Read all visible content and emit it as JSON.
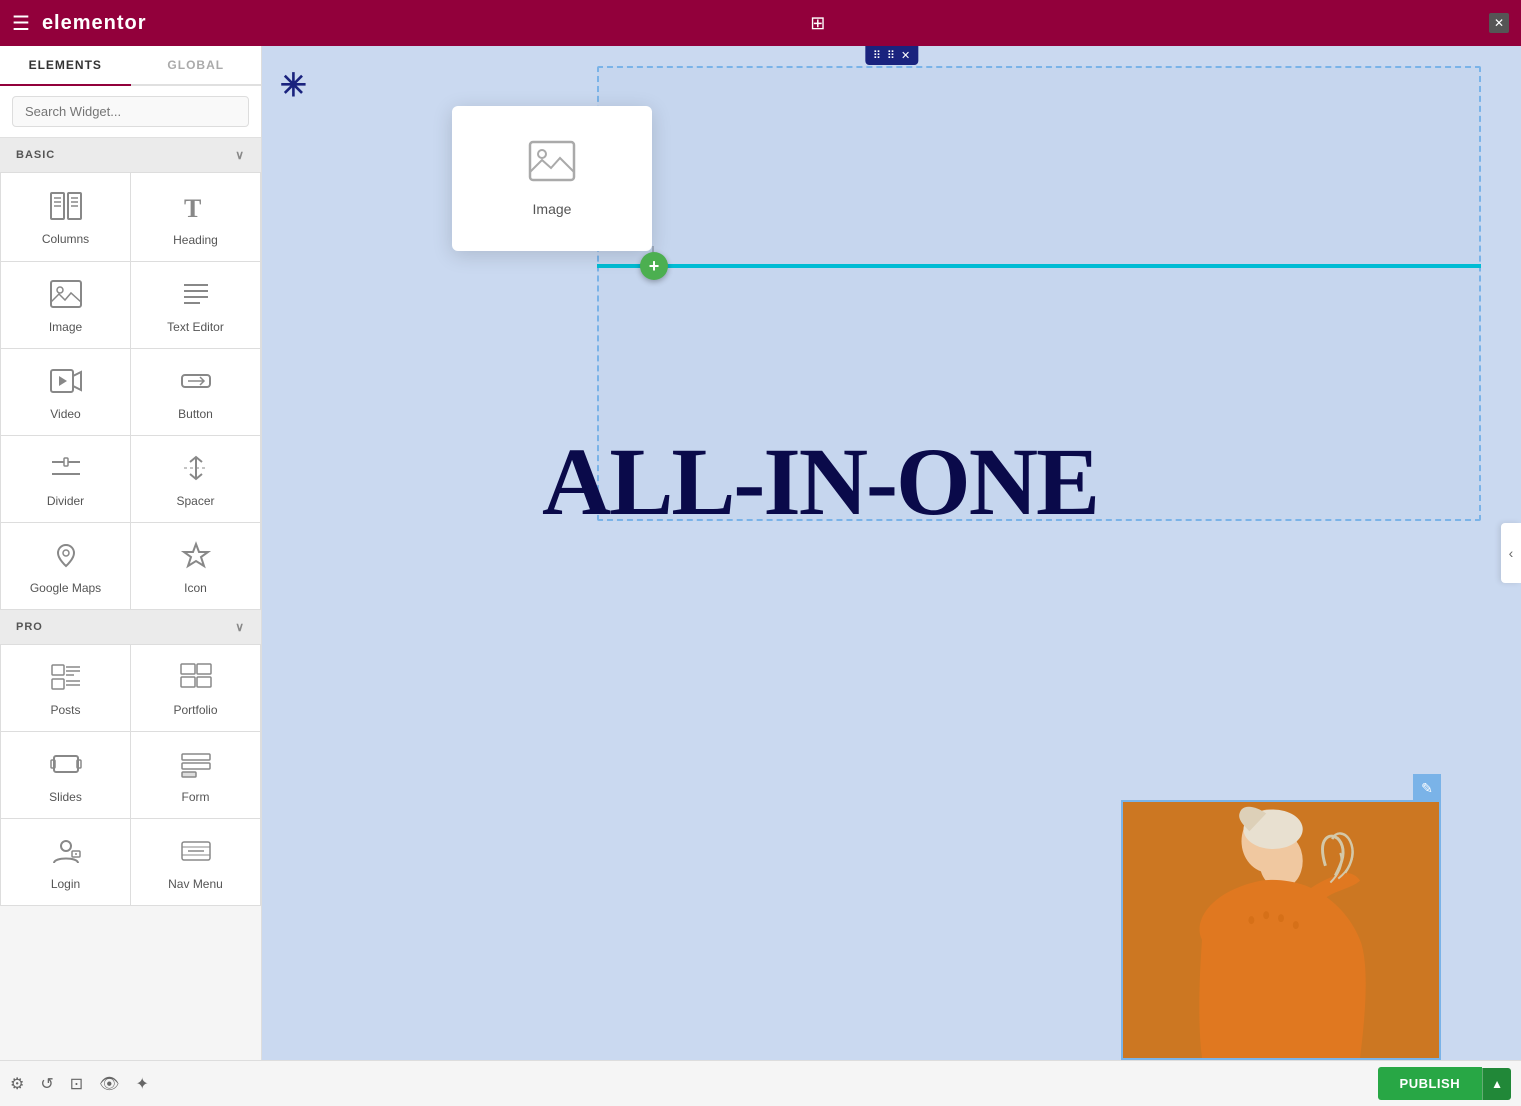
{
  "topbar": {
    "logo_text": "elementor",
    "hamburger_title": "Menu",
    "grid_title": "Apps",
    "close_title": "Close"
  },
  "panel": {
    "tab_elements": "ELEMENTS",
    "tab_global": "GLOBAL",
    "search_placeholder": "Search Widget...",
    "section_basic": "BASIC",
    "section_pro": "PRO",
    "basic_widgets": [
      {
        "id": "columns",
        "label": "Columns",
        "icon": "columns"
      },
      {
        "id": "heading",
        "label": "Heading",
        "icon": "heading"
      },
      {
        "id": "image",
        "label": "Image",
        "icon": "image"
      },
      {
        "id": "text-editor",
        "label": "Text Editor",
        "icon": "text-editor"
      },
      {
        "id": "video",
        "label": "Video",
        "icon": "video"
      },
      {
        "id": "button",
        "label": "Button",
        "icon": "button"
      },
      {
        "id": "divider",
        "label": "Divider",
        "icon": "divider"
      },
      {
        "id": "spacer",
        "label": "Spacer",
        "icon": "spacer"
      },
      {
        "id": "google-maps",
        "label": "Google Maps",
        "icon": "google-maps"
      },
      {
        "id": "icon",
        "label": "Icon",
        "icon": "icon"
      }
    ],
    "pro_widgets": [
      {
        "id": "posts",
        "label": "Posts",
        "icon": "posts"
      },
      {
        "id": "portfolio",
        "label": "Portfolio",
        "icon": "portfolio"
      },
      {
        "id": "slides",
        "label": "Slides",
        "icon": "slides"
      },
      {
        "id": "form",
        "label": "Form",
        "icon": "form"
      },
      {
        "id": "login",
        "label": "Login",
        "icon": "login"
      },
      {
        "id": "nav-menu",
        "label": "Nav Menu",
        "icon": "table"
      }
    ]
  },
  "bottombar": {
    "publish_label": "PUBLISH",
    "icons": [
      "settings",
      "history",
      "responsive",
      "display",
      "visible"
    ]
  },
  "canvas": {
    "drag_tooltip_move": "⠿",
    "drag_tooltip_close": "✕",
    "image_widget_label": "Image",
    "all_in_one_text": "ALL-IN-ONE",
    "add_button_label": "+",
    "edit_badge_label": "✎"
  }
}
